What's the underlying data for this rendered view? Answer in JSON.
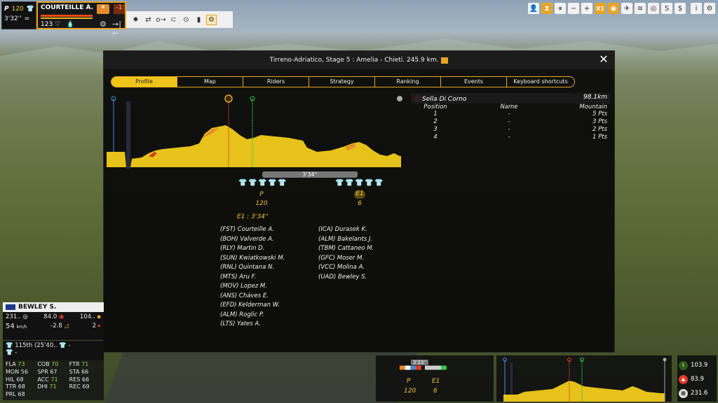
{
  "top_left": {
    "rider_class": "P",
    "rank_num": "120",
    "time": "3'32''",
    "icon": "jersey-icon"
  },
  "rider_card": {
    "name": "COURTEILLE A.",
    "delta": "-1",
    "energy": "123"
  },
  "toolbar": {
    "speed": "X1"
  },
  "dialog": {
    "title": "Tirreno-Adriatico, Stage 5 : Amelia - Chieti. 245.9 km.",
    "tabs": [
      "Profile",
      "Map",
      "Riders",
      "Strategy",
      "Ranking",
      "Events",
      "Keyboard shortcuts"
    ],
    "active_tab": "Profile",
    "time_gap": "3'34''",
    "group_p": {
      "label": "P",
      "count": "120"
    },
    "group_e1": {
      "label": "E1",
      "count": "6"
    },
    "group_title": "E1 : 3'34''",
    "riders_left": [
      "(FST) Courteille A.",
      "(BOH) Valverde A.",
      "(RLY) Martin D.",
      "(SUN) Kwiatkowski M.",
      "(RNL) Quintana N.",
      "(MTS) Aru F.",
      "(MOV) Lopez M.",
      "(ANS) Cháves E.",
      "(EFD) Kelderman W.",
      "(ALM) Roglic P.",
      "(LTS) Yates A."
    ],
    "riders_right": [
      "(ICA) Durasek K.",
      "(ALM) Bakelants J.",
      "(TBM) Cattaneo M.",
      "(GFC) Moser M.",
      "(VCC) Molina A.",
      "(UAD) Bewley S."
    ],
    "mountain": {
      "name": "Sella Di Corno",
      "distance": "98.1km",
      "headers": [
        "Position",
        "Name",
        "Mountain"
      ],
      "rows": [
        {
          "pos": "1",
          "name": "-",
          "pts": "5 Pts"
        },
        {
          "pos": "2",
          "name": "-",
          "pts": "3 Pts"
        },
        {
          "pos": "3",
          "name": "-",
          "pts": "2 Pts"
        },
        {
          "pos": "4",
          "name": "-",
          "pts": "1 Pts"
        }
      ]
    }
  },
  "bottom_left": {
    "name": "BEWLEY S.",
    "stat_a": "231..",
    "stat_b": "84.0",
    "stat_c": "104..",
    "speed": "54",
    "speed_unit": "km/h",
    "gradient": "-2.8",
    "stat_d": "2",
    "rank": "115th (25'40..",
    "dash": "-",
    "attrs": [
      [
        "FLA",
        "73",
        "COB",
        "70",
        "FTR",
        "71"
      ],
      [
        "MON",
        "56",
        "SPR",
        "67",
        "STA",
        "66"
      ],
      [
        "HIL",
        "68",
        "ACC",
        "71",
        "RES",
        "66"
      ],
      [
        "TTR",
        "68",
        "DHI",
        "71",
        "REC",
        "69"
      ],
      [
        "PRL",
        "68",
        "",
        "",
        "",
        ""
      ]
    ]
  },
  "mini_groups": {
    "time": "3'33''",
    "p_label": "P",
    "p_count": "120",
    "e1_label": "E1",
    "e1_count": "6"
  },
  "stage_info": {
    "remaining": "103.9",
    "done": "83.9",
    "total": "231.6"
  },
  "colors": {
    "accent": "#e6a428",
    "profile_fill": "#e6c21a",
    "sprint_line": "#2ecc40",
    "kom_line": "#e03a2a"
  }
}
